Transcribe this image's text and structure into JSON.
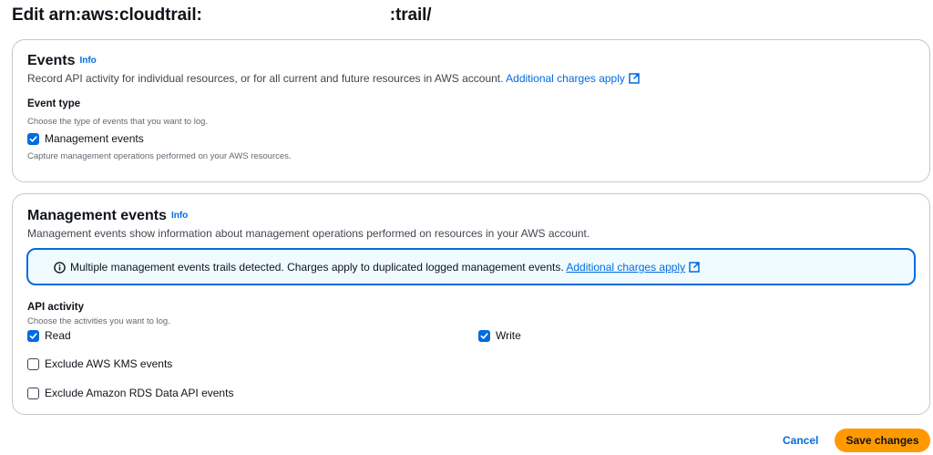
{
  "page": {
    "title_part1": "Edit arn:aws:cloudtrail:",
    "title_part2": ":trail/"
  },
  "events_panel": {
    "heading": "Events",
    "info": "Info",
    "description": "Record API activity for individual resources, or for all current and future resources in AWS account.",
    "charges_link": "Additional charges apply",
    "event_type_label": "Event type",
    "event_type_hint": "Choose the type of events that you want to log.",
    "management_events_checkbox": {
      "label": "Management events",
      "checked": true
    },
    "management_events_hint": "Capture management operations performed on your AWS resources."
  },
  "management_panel": {
    "heading": "Management events",
    "info": "Info",
    "description": "Management events show information about management operations performed on resources in your AWS account.",
    "alert_text": "Multiple management events trails detected. Charges apply to duplicated logged management events.",
    "alert_link": "Additional charges apply",
    "api_activity_label": "API activity",
    "api_activity_hint": "Choose the activities you want to log.",
    "read_checkbox": {
      "label": "Read",
      "checked": true
    },
    "write_checkbox": {
      "label": "Write",
      "checked": true
    },
    "exclude_kms_checkbox": {
      "label": "Exclude AWS KMS events",
      "checked": false
    },
    "exclude_rds_checkbox": {
      "label": "Exclude Amazon RDS Data API events",
      "checked": false
    }
  },
  "footer": {
    "cancel_label": "Cancel",
    "save_label": "Save changes"
  },
  "colors": {
    "accent": "#006ce0",
    "primary_button": "#ff9900",
    "alert_background": "#f0fbff"
  }
}
